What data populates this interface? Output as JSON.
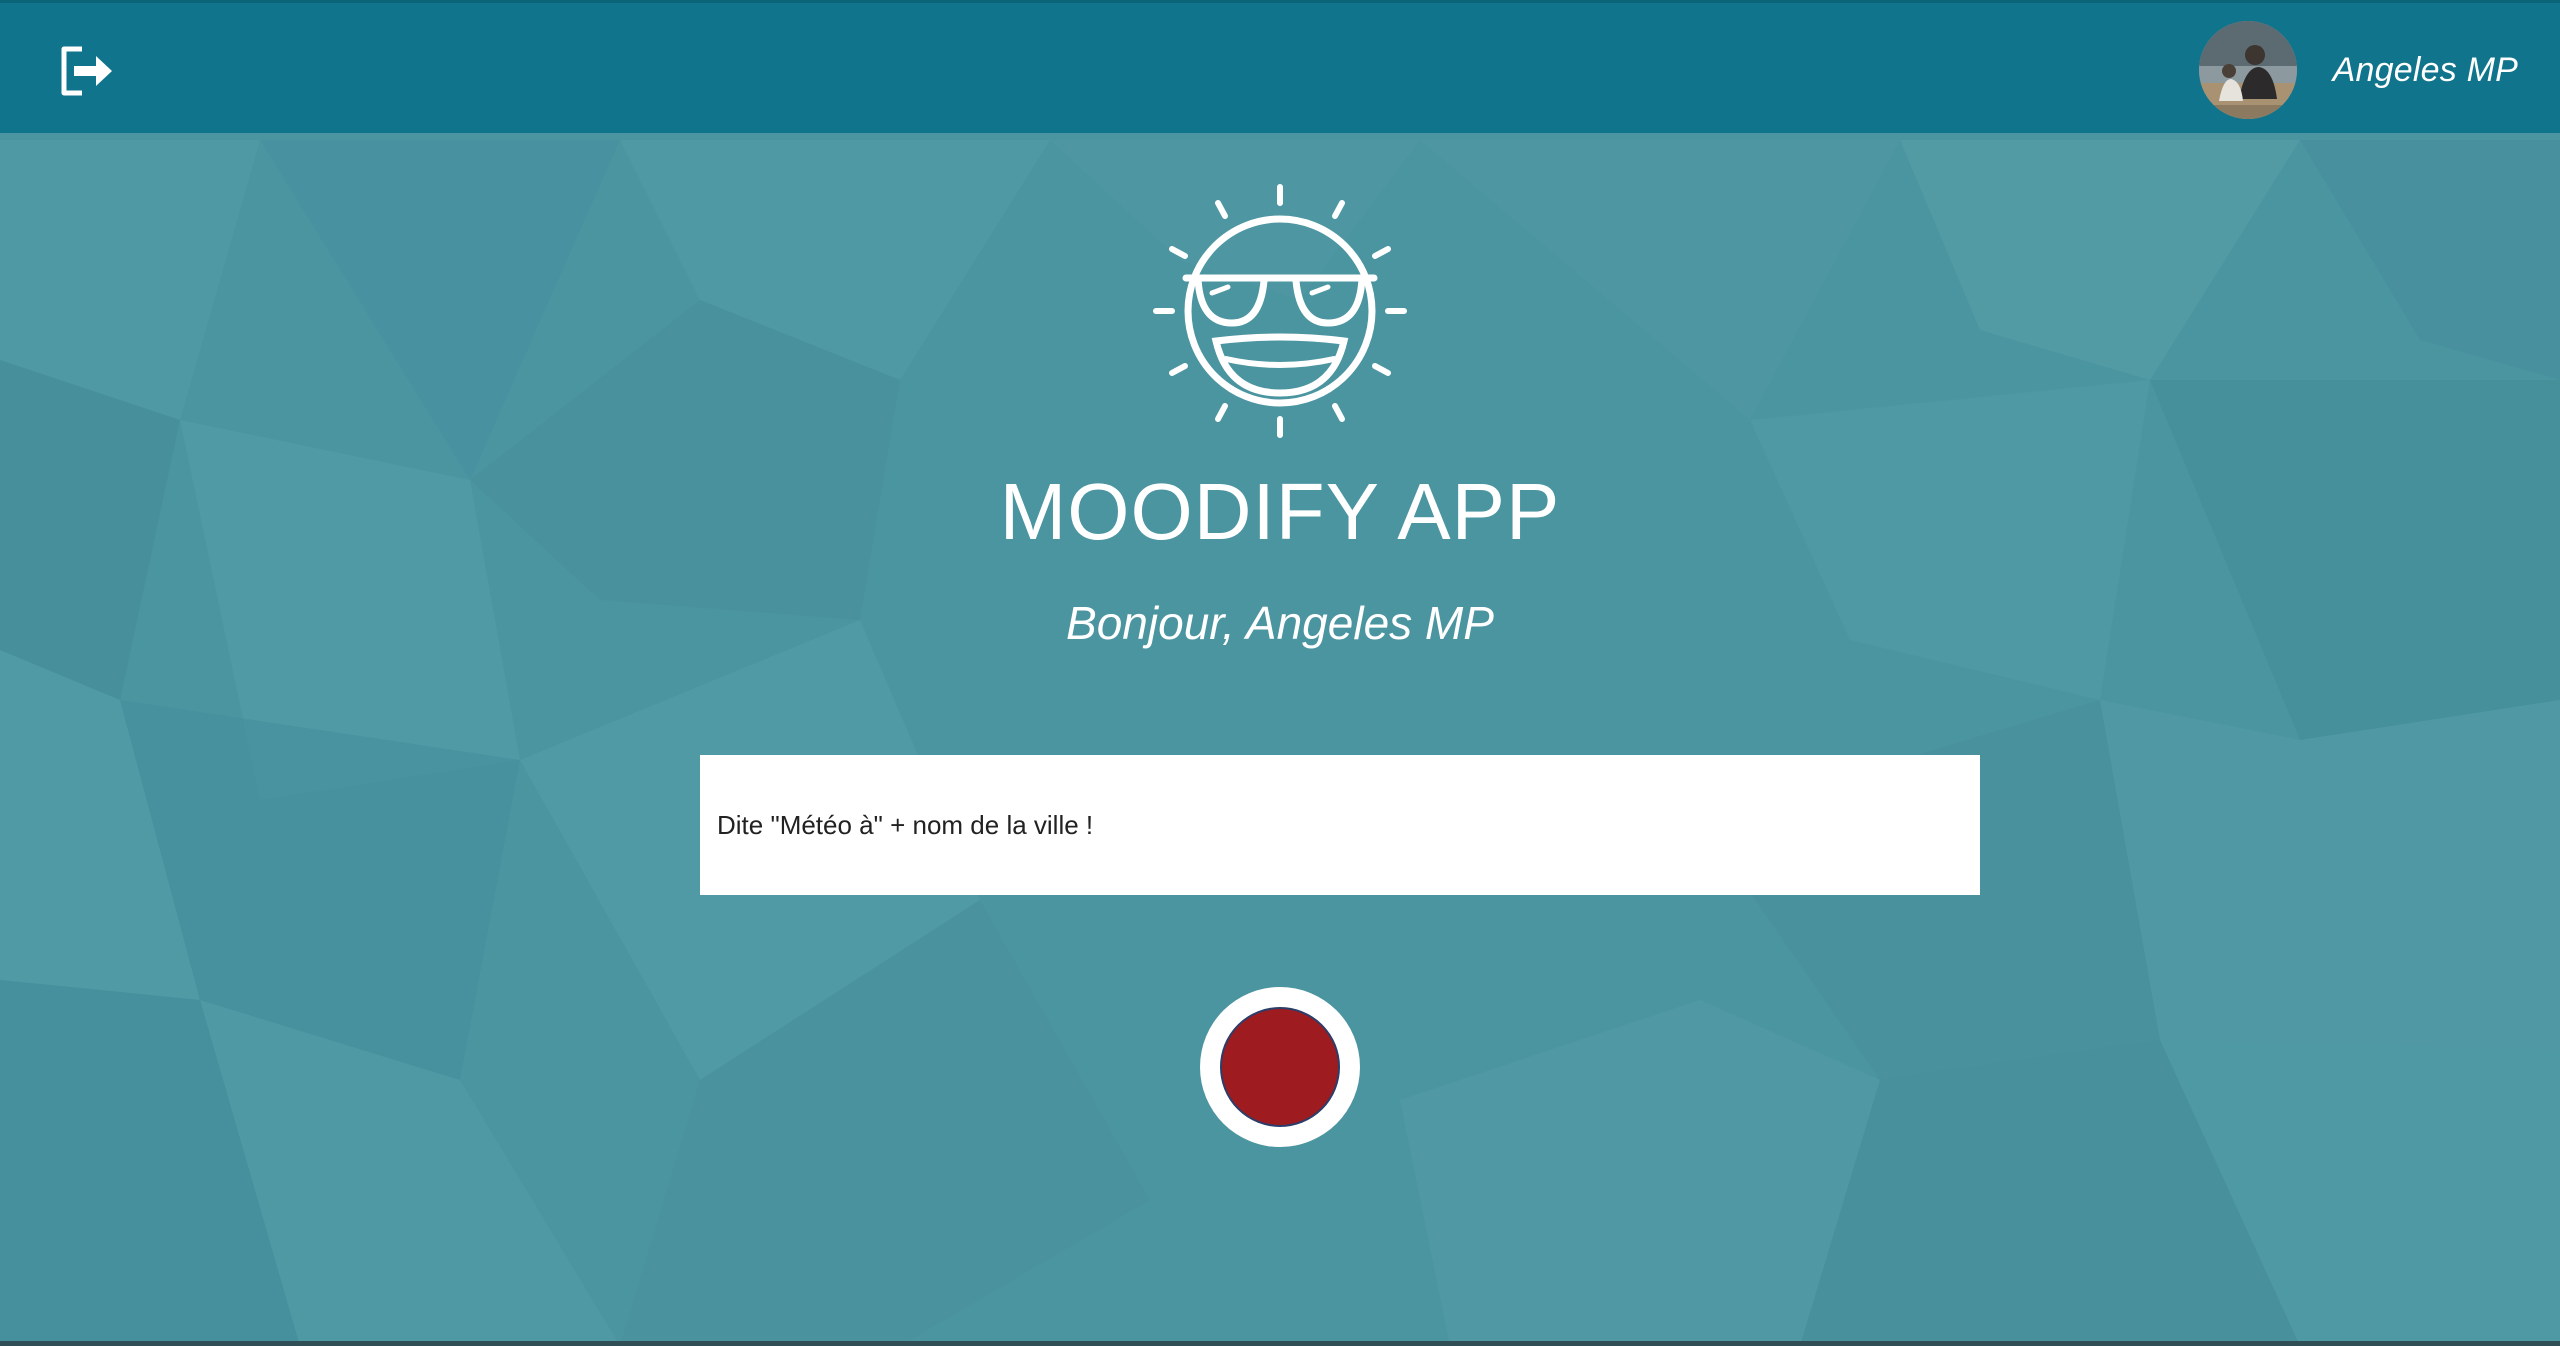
{
  "colors": {
    "navbar": "#10758c",
    "background": "#4b95a1",
    "record_button": "#9e1c1f"
  },
  "navbar": {
    "logout_icon": "logout-icon",
    "user": {
      "name": "Angeles MP",
      "avatar_icon": "avatar-photo"
    }
  },
  "main": {
    "logo_icon": "sunglasses-sun-icon",
    "title": "MOODIFY APP",
    "greeting": "Bonjour, Angeles MP",
    "prompt": "Dite \"Météo à\" + nom de la ville !",
    "record_icon": "record-icon"
  }
}
